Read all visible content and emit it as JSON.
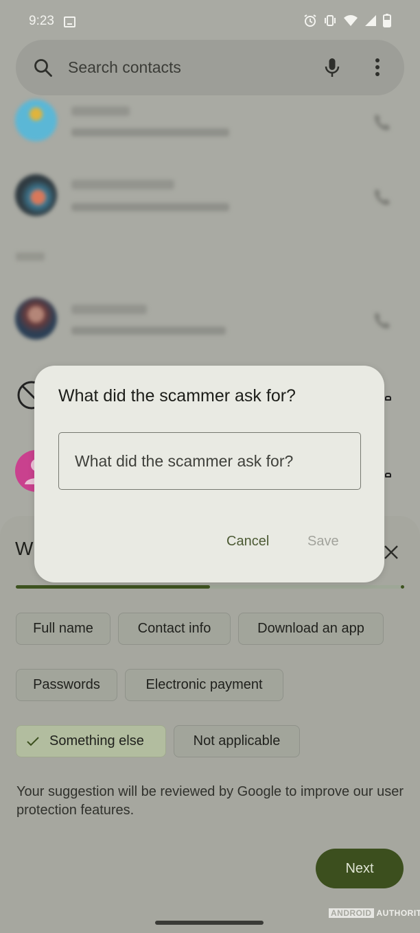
{
  "status_bar": {
    "time": "9:23",
    "icons": [
      "image-notification-icon",
      "alarm-icon",
      "vibrate-icon",
      "wifi-icon",
      "cellular-signal-icon",
      "battery-icon"
    ]
  },
  "search": {
    "placeholder": "Search contacts",
    "icons": [
      "search-icon",
      "mic-icon",
      "more-vert-icon"
    ]
  },
  "call_log": {
    "entries": [
      {
        "avatar_color": "#5bb7d6",
        "blurred": true
      },
      {
        "avatar_color": "#3e7e9a",
        "blurred": true
      },
      {
        "avatar_color": "#6a3a3a",
        "blurred": true
      }
    ]
  },
  "bottom_sheet": {
    "title_partial": "W",
    "progress_fraction": 0.5,
    "chips": [
      {
        "label": "Full name",
        "selected": false
      },
      {
        "label": "Contact info",
        "selected": false
      },
      {
        "label": "Download an app",
        "selected": false
      },
      {
        "label": "Passwords",
        "selected": false
      },
      {
        "label": "Electronic payment",
        "selected": false
      },
      {
        "label": "Something else",
        "selected": true
      },
      {
        "label": "Not applicable",
        "selected": false
      }
    ],
    "disclaimer": "Your suggestion will be reviewed by Google to improve our user protection features.",
    "next_label": "Next"
  },
  "dialog": {
    "title": "What did the scammer ask for?",
    "input_placeholder": "What did the scammer ask for?",
    "input_value": "",
    "cancel_label": "Cancel",
    "save_label": "Save"
  },
  "watermark": {
    "part1": "ANDROID",
    "part2": "AUTHORITY"
  },
  "colors": {
    "accent": "#3c4f1e",
    "selected_chip": "#b2bd9f",
    "dialog_bg": "#e9eae3"
  }
}
